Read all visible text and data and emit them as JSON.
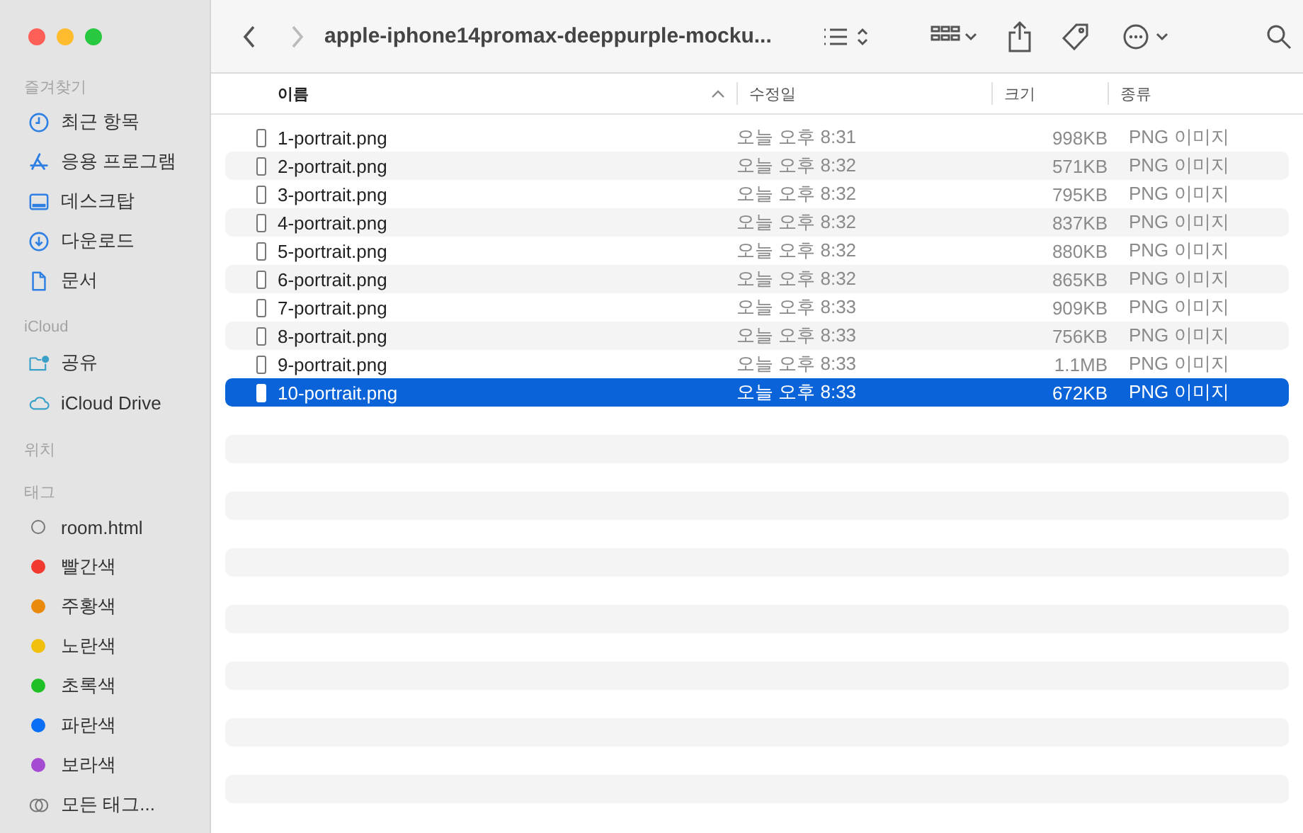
{
  "window": {
    "title": "apple-iphone14promax-deeppurple-mocku..."
  },
  "toolbar": {
    "back_disabled": false,
    "forward_disabled": true
  },
  "sidebar": [
    {
      "kind": "header",
      "label": "즐겨찾기"
    },
    {
      "kind": "item",
      "label": "최근 항목"
    },
    {
      "kind": "item",
      "label": "응용 프로그램"
    },
    {
      "kind": "item",
      "label": "데스크탑"
    },
    {
      "kind": "item",
      "label": "다운로드"
    },
    {
      "kind": "item",
      "label": "문서"
    },
    {
      "kind": "header",
      "label": "iCloud"
    },
    {
      "kind": "item",
      "label": "공유"
    },
    {
      "kind": "item",
      "label": "iCloud Drive"
    },
    {
      "kind": "header",
      "label": "위치"
    },
    {
      "kind": "header",
      "label": "태그"
    },
    {
      "kind": "tag",
      "label": "room.html"
    },
    {
      "kind": "tag",
      "label": "빨간색",
      "color": "#f2392f"
    },
    {
      "kind": "tag",
      "label": "주황색",
      "color": "#ea8a0c"
    },
    {
      "kind": "tag",
      "label": "노란색",
      "color": "#f0c00c"
    },
    {
      "kind": "tag",
      "label": "초록색",
      "color": "#1fbf26"
    },
    {
      "kind": "tag",
      "label": "파란색",
      "color": "#0b6ff5"
    },
    {
      "kind": "tag",
      "label": "보라색",
      "color": "#a54bd1"
    },
    {
      "kind": "alltags",
      "label": "모든 태그..."
    }
  ],
  "columns": [
    {
      "label": "이름",
      "sorted": true
    },
    {
      "label": "수정일",
      "sorted": false
    },
    {
      "label": "크기",
      "sorted": false
    },
    {
      "label": "종류",
      "sorted": false
    }
  ],
  "rows": [
    {
      "name": "1-portrait.png",
      "modified": "오늘 오후 8:31",
      "size": "998KB",
      "kind": "PNG 이미지",
      "selected": false
    },
    {
      "name": "2-portrait.png",
      "modified": "오늘 오후 8:32",
      "size": "571KB",
      "kind": "PNG 이미지",
      "selected": false
    },
    {
      "name": "3-portrait.png",
      "modified": "오늘 오후 8:32",
      "size": "795KB",
      "kind": "PNG 이미지",
      "selected": false
    },
    {
      "name": "4-portrait.png",
      "modified": "오늘 오후 8:32",
      "size": "837KB",
      "kind": "PNG 이미지",
      "selected": false
    },
    {
      "name": "5-portrait.png",
      "modified": "오늘 오후 8:32",
      "size": "880KB",
      "kind": "PNG 이미지",
      "selected": false
    },
    {
      "name": "6-portrait.png",
      "modified": "오늘 오후 8:32",
      "size": "865KB",
      "kind": "PNG 이미지",
      "selected": false
    },
    {
      "name": "7-portrait.png",
      "modified": "오늘 오후 8:33",
      "size": "909KB",
      "kind": "PNG 이미지",
      "selected": false
    },
    {
      "name": "8-portrait.png",
      "modified": "오늘 오후 8:33",
      "size": "756KB",
      "kind": "PNG 이미지",
      "selected": false
    },
    {
      "name": "9-portrait.png",
      "modified": "오늘 오후 8:33",
      "size": "1.1MB",
      "kind": "PNG 이미지",
      "selected": false
    },
    {
      "name": "10-portrait.png",
      "modified": "오늘 오후 8:33",
      "size": "672KB",
      "kind": "PNG 이미지",
      "selected": true
    }
  ]
}
